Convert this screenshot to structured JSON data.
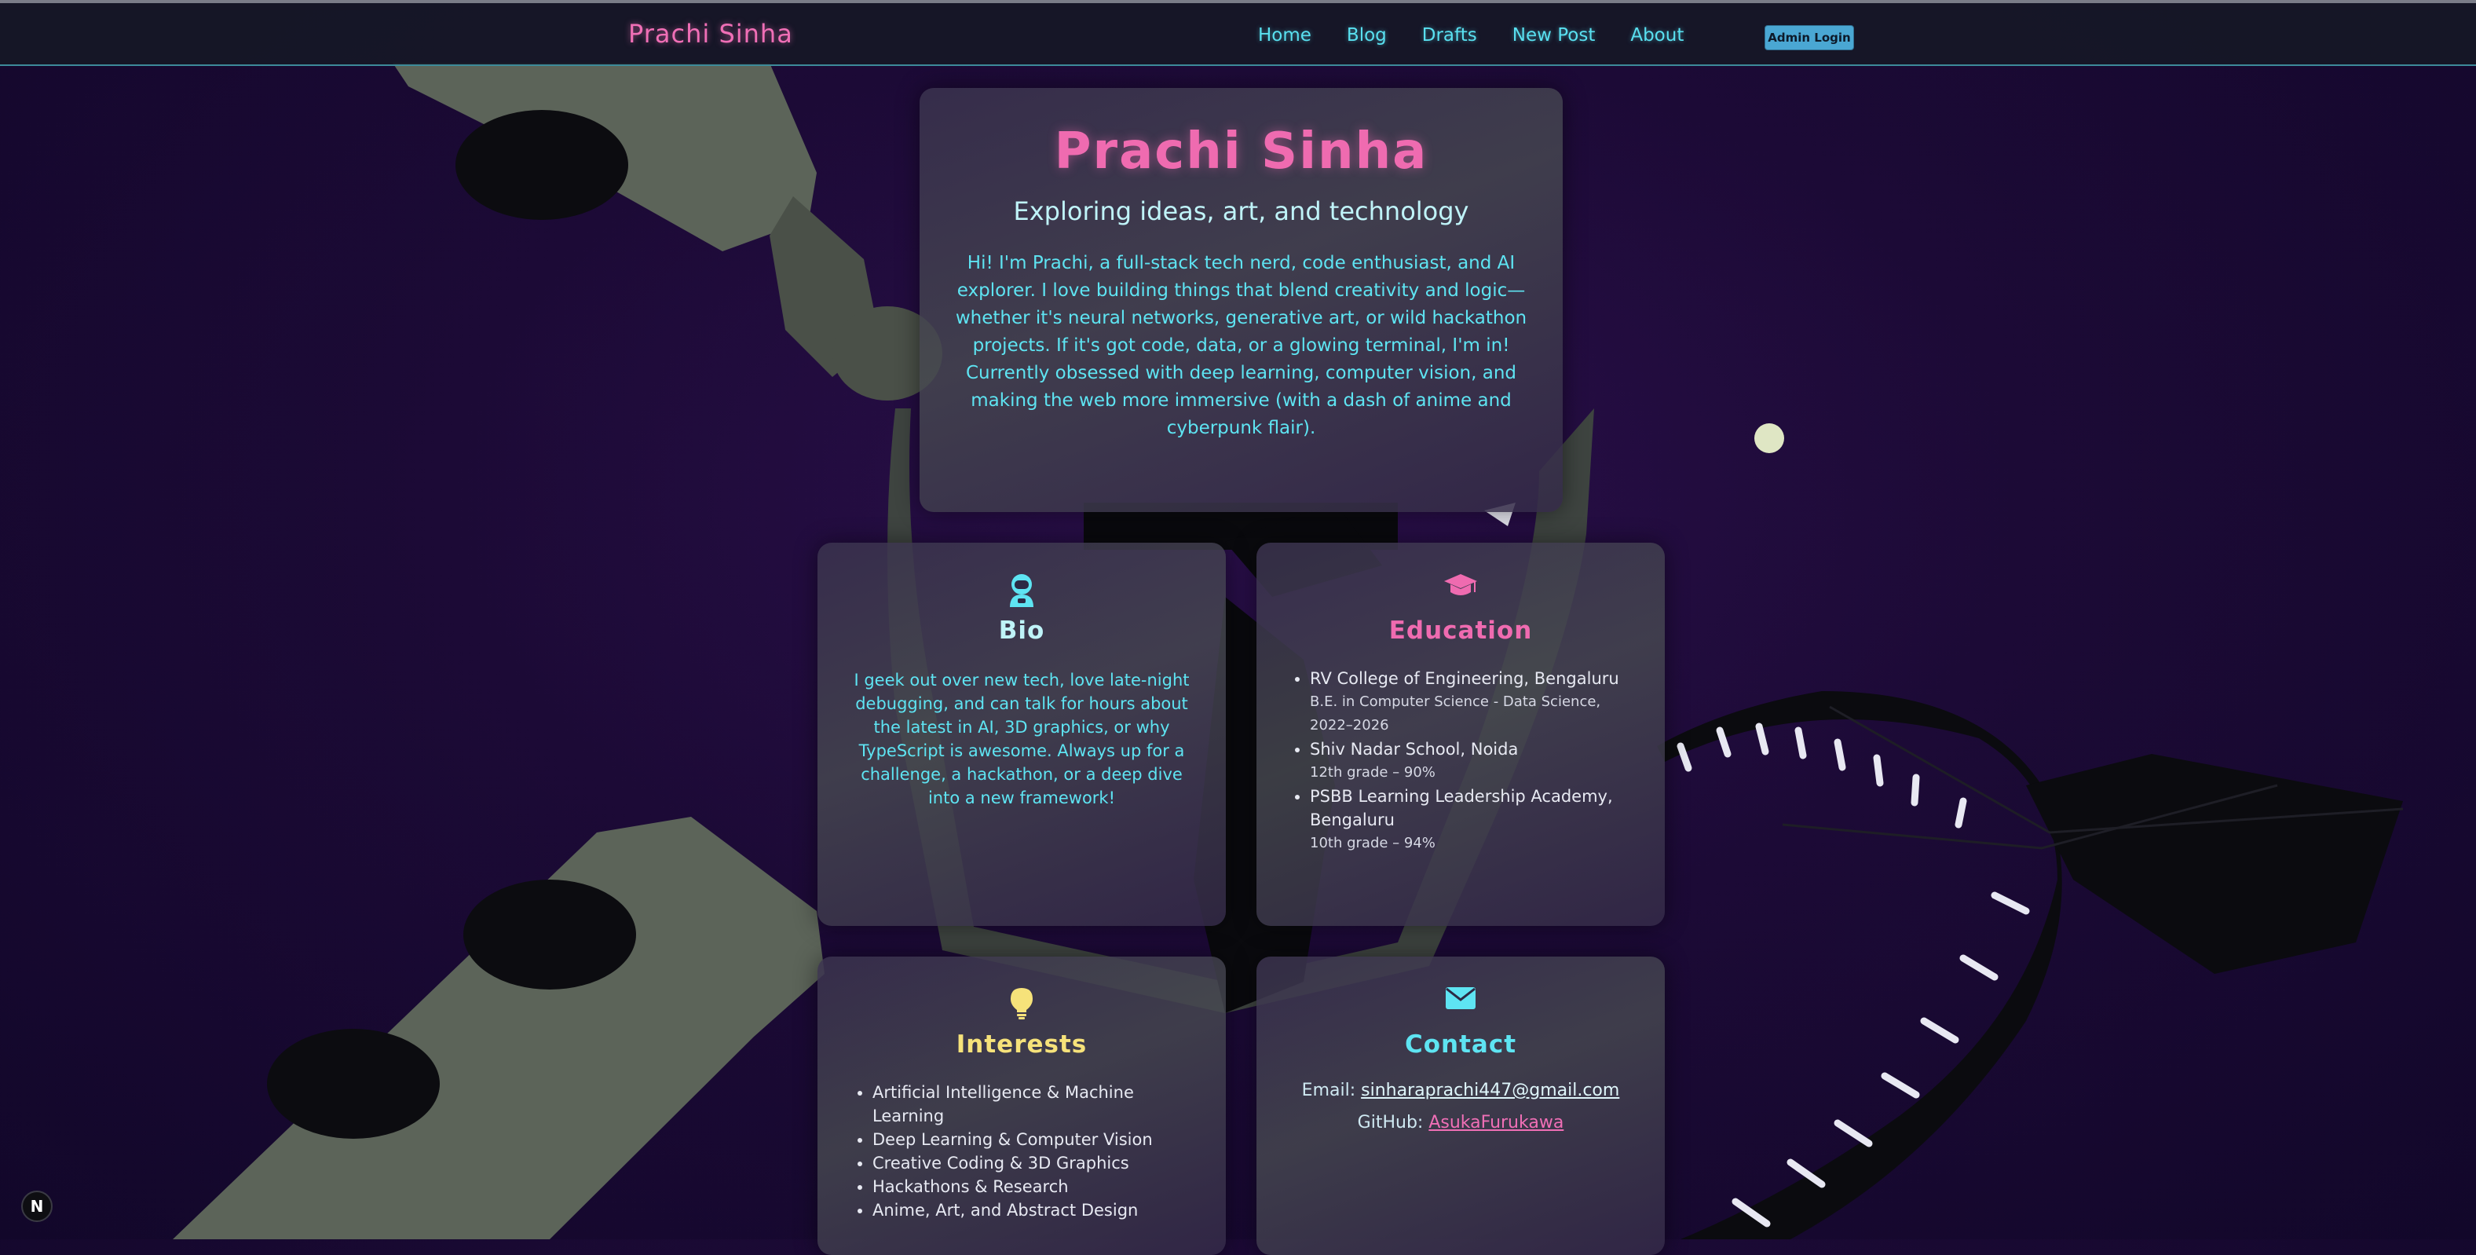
{
  "navbar": {
    "brand": "Prachi Sinha",
    "links": [
      "Home",
      "Blog",
      "Drafts",
      "New Post",
      "About"
    ],
    "admin_button": "Admin Login"
  },
  "hero": {
    "title": "Prachi Sinha",
    "subtitle": "Exploring ideas, art, and technology",
    "paragraph_1": "Hi! I'm Prachi, a full-stack tech nerd, code enthusiast, and AI explorer. I love building things that blend creativity and logic—whether it's neural networks, generative art, or wild hackathon projects. If it's got code, data, or a glowing terminal, I'm in!",
    "paragraph_2": "Currently obsessed with deep learning, computer vision, and making the web more immersive (with a dash of anime and cyberpunk flair)."
  },
  "bio": {
    "icon": "astronaut-icon",
    "title": "Bio",
    "text": "I geek out over new tech, love late-night debugging, and can talk for hours about the latest in AI, 3D graphics, or why TypeScript is awesome. Always up for a challenge, a hackathon, or a deep dive into a new framework!"
  },
  "education": {
    "icon": "graduation-cap-icon",
    "title": "Education",
    "items": [
      {
        "name": "RV College of Engineering, Bengaluru",
        "detail": "B.E. in Computer Science - Data Science, 2022–2026"
      },
      {
        "name": "Shiv Nadar School, Noida",
        "detail": "12th grade – 90%"
      },
      {
        "name": "PSBB Learning Leadership Academy, Bengaluru",
        "detail": "10th grade – 94%"
      }
    ]
  },
  "interests": {
    "icon": "lightbulb-icon",
    "title": "Interests",
    "items": [
      "Artificial Intelligence & Machine Learning",
      "Deep Learning & Computer Vision",
      "Creative Coding & 3D Graphics",
      "Hackathons & Research",
      "Anime, Art, and Abstract Design"
    ]
  },
  "contact": {
    "icon": "envelope-icon",
    "title": "Contact",
    "email_label": "Email:",
    "email": "sinharaprachi447@gmail.com",
    "github_label": "GitHub:",
    "github": "AsukaFurukawa"
  },
  "badge": "N",
  "colors": {
    "pink": "#ef6bb0",
    "cyan": "#5ee4f2",
    "yellow": "#f6e27a",
    "background": "#1c0a36"
  }
}
